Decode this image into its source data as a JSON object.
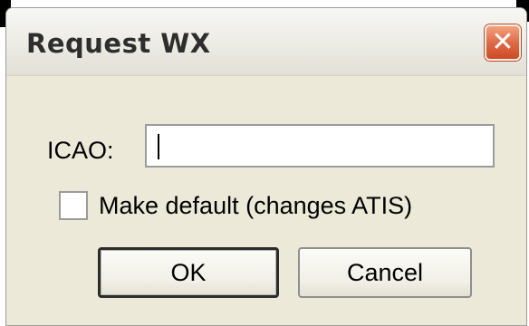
{
  "dialog": {
    "title": "Request WX",
    "close_label": "✕"
  },
  "form": {
    "icao_label": "ICAO:",
    "icao_value": "",
    "default_checkbox_label": "Make default (changes ATIS)",
    "default_checked": false
  },
  "buttons": {
    "ok_label": "OK",
    "cancel_label": "Cancel"
  }
}
